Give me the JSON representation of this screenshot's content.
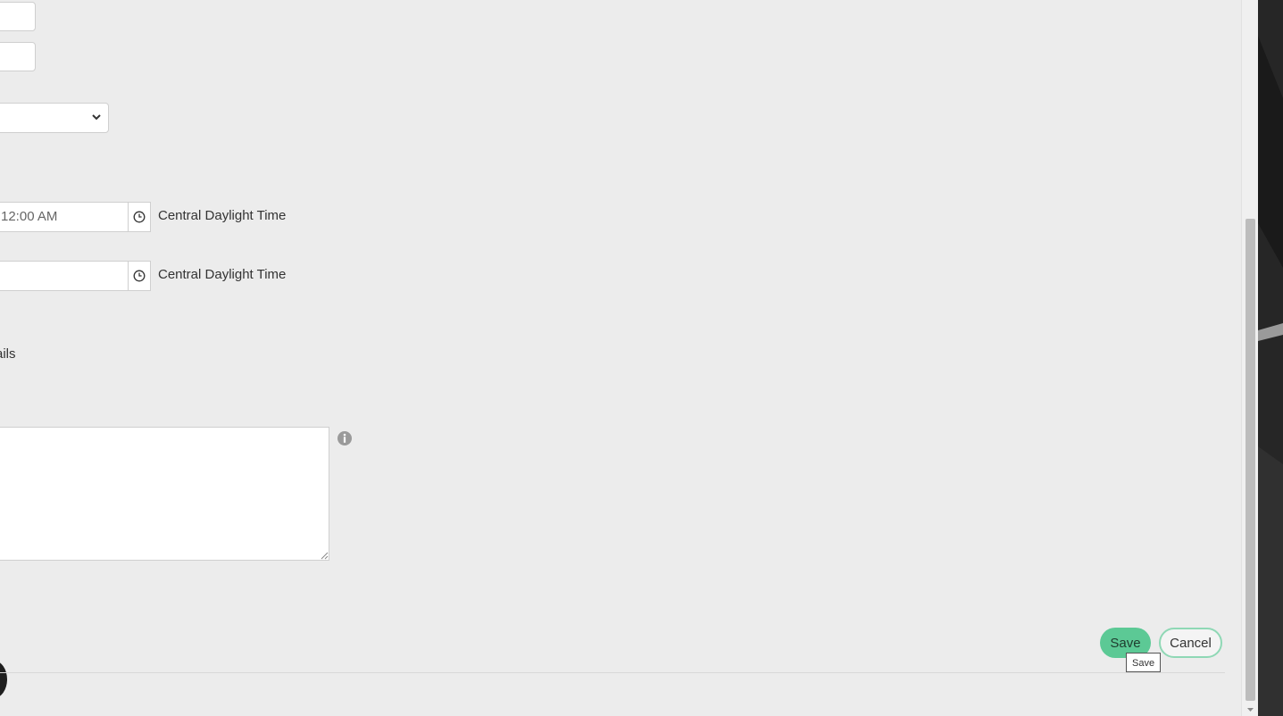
{
  "form": {
    "start_time": {
      "value": "12:00 AM",
      "timezone": "Central Daylight Time"
    },
    "end_time": {
      "value": "",
      "timezone": "Central Daylight Time"
    },
    "section_label": "ails",
    "description": ""
  },
  "actions": {
    "save_label": "Save",
    "cancel_label": "Cancel",
    "save_tooltip": "Save"
  },
  "colors": {
    "save_button": "#5cc995",
    "cancel_border": "#8fd8b5",
    "background": "#ececec"
  },
  "icons": [
    "clock-icon",
    "info-icon",
    "chevron-down-icon",
    "resize-grip-icon",
    "scroll-down-arrow-icon"
  ]
}
